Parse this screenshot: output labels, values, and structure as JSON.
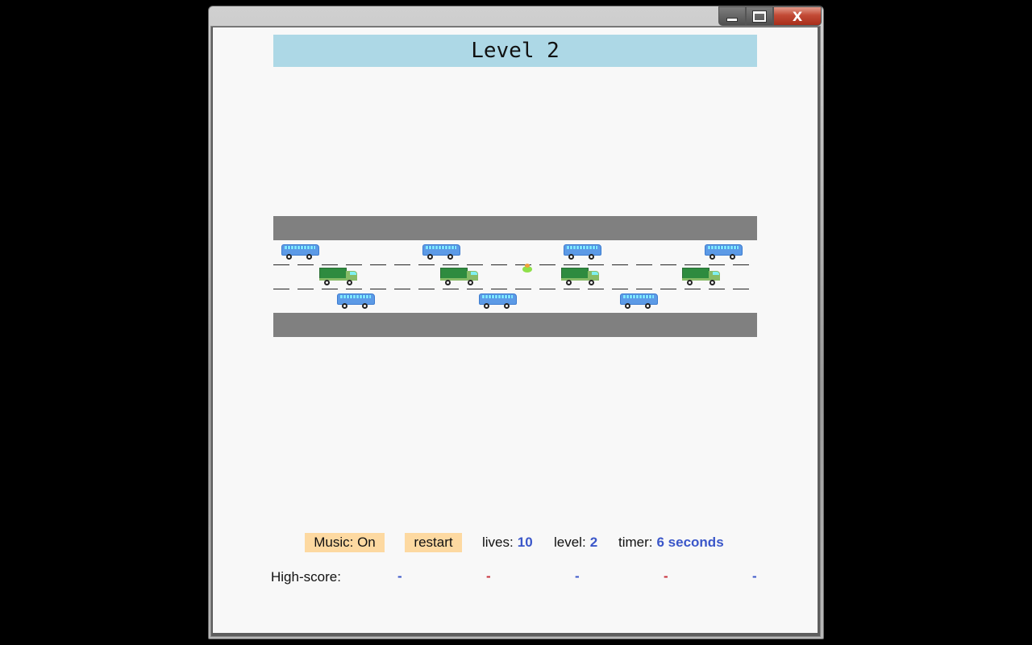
{
  "window": {
    "controls": {
      "minimize": "minimize",
      "maximize": "maximize",
      "close": "X"
    }
  },
  "game": {
    "title": "Level 2",
    "music_button": "Music: On",
    "restart_button": "restart",
    "lives_label": "lives:",
    "lives_value": "10",
    "level_label": "level:",
    "level_value": "2",
    "timer_label": "timer:",
    "timer_value": "6 seconds",
    "highscore_label": "High-score:",
    "highscores": [
      "-",
      "-",
      "-",
      "-",
      "-"
    ]
  },
  "colors": {
    "title_bg": "#add8e6",
    "button_bg": "#fdd9a1",
    "value_blue": "#3b57c9",
    "score_red": "#c8313b",
    "road_curb": "#808080"
  },
  "entities": {
    "buses_lane1": 4,
    "trucks_lane2": 4,
    "buses_lane3": 3,
    "player": "frog-icon"
  }
}
